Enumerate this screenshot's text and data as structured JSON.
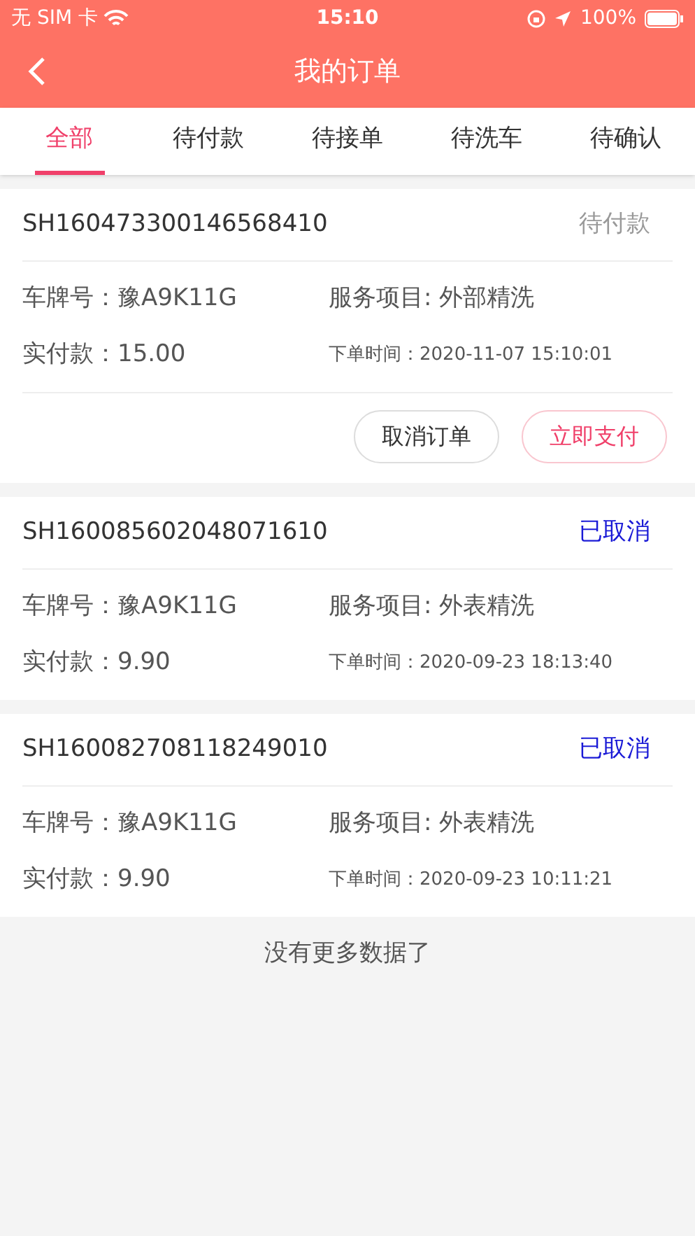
{
  "status_bar": {
    "carrier": "无 SIM 卡",
    "time": "15:10",
    "battery": "100%"
  },
  "nav": {
    "title": "我的订单"
  },
  "tabs": [
    {
      "label": "全部",
      "selected": true
    },
    {
      "label": "待付款",
      "selected": false
    },
    {
      "label": "待接单",
      "selected": false
    },
    {
      "label": "待洗车",
      "selected": false
    },
    {
      "label": "待确认",
      "selected": false
    }
  ],
  "orders": [
    {
      "order_no": "SH160473300146568410",
      "status": "待付款",
      "kind": "pending",
      "plate": "车牌号：豫A9K11G",
      "service": "服务项目: 外部精洗",
      "paid": "实付款：15.00",
      "time": "下单时间：2020-11-07 15:10:01",
      "actions": [
        {
          "label": "取消订单",
          "kind": "secondary"
        },
        {
          "label": "立即支付",
          "kind": "primary"
        }
      ]
    },
    {
      "order_no": "SH160085602048071610",
      "status": "已取消",
      "kind": "cancelled",
      "plate": "车牌号：豫A9K11G",
      "service": "服务项目: 外表精洗",
      "paid": "实付款：9.90",
      "time": "下单时间：2020-09-23 18:13:40"
    },
    {
      "order_no": "SH160082708118249010",
      "status": "已取消",
      "kind": "cancelled",
      "plate": "车牌号：豫A9K11G",
      "service": "服务项目: 外表精洗",
      "paid": "实付款：9.90",
      "time": "下单时间：2020-09-23 10:11:21"
    }
  ],
  "footer": "没有更多数据了"
}
